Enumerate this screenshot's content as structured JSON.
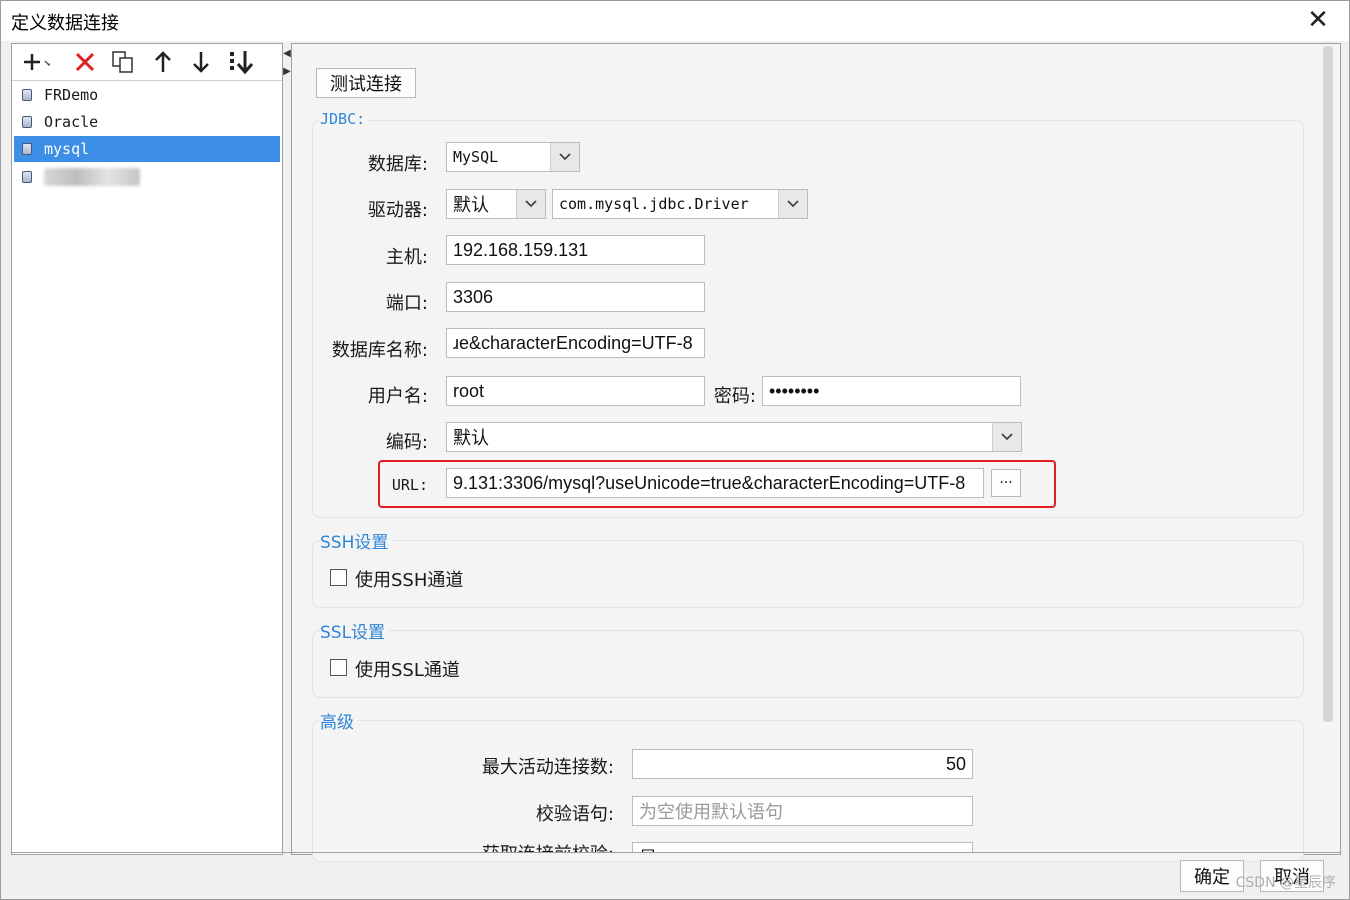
{
  "window": {
    "title": "定义数据连接",
    "close_glyph": "✕"
  },
  "toolbar": {
    "items": [
      {
        "name": "add",
        "glyph": "+▾"
      },
      {
        "name": "delete",
        "glyph": "✕"
      },
      {
        "name": "copy",
        "glyph": "⧉"
      },
      {
        "name": "move-up",
        "glyph": "↑"
      },
      {
        "name": "move-down",
        "glyph": "↓"
      },
      {
        "name": "sort",
        "glyph": "⇊"
      }
    ]
  },
  "connections": [
    {
      "label": "FRDemo",
      "selected": false
    },
    {
      "label": "Oracle",
      "selected": false
    },
    {
      "label": "mysql",
      "selected": true
    },
    {
      "label": "",
      "selected": false,
      "obscured": true
    }
  ],
  "right": {
    "test_button": "测试连接",
    "jdbc_section": "JDBC:",
    "labels": {
      "database": "数据库:",
      "driver": "驱动器:",
      "host": "主机:",
      "port": "端口:",
      "db_name": "数据库名称:",
      "username": "用户名:",
      "password": "密码:",
      "encoding": "编码:",
      "url": "URL:"
    },
    "values": {
      "database": "MySQL",
      "driver_mode": "默认",
      "driver_class": "com.mysql.jdbc.Driver",
      "host": "192.168.159.131",
      "port": "3306",
      "db_name": "ɹe&characterEncoding=UTF-8",
      "username": "root",
      "password": "••••••••",
      "encoding": "默认",
      "url": "9.131:3306/mysql?useUnicode=true&characterEncoding=UTF-8",
      "url_more": "···"
    },
    "ssh_section": "SSH设置",
    "ssh_checkbox": "使用SSH通道",
    "ssl_section": "SSL设置",
    "ssl_checkbox": "使用SSL通道",
    "advanced_section": "高级",
    "advanced": {
      "max_active_label": "最大活动连接数:",
      "max_active_value": "50",
      "validation_label": "校验语句:",
      "validation_placeholder": "为空使用默认语句",
      "partial_label": "获取连接前校验:",
      "partial_value": "是"
    }
  },
  "footer": {
    "ok": "确定",
    "cancel": "取消",
    "watermark": "CSDN @星辰序"
  },
  "colors": {
    "accent": "#2f86d6",
    "selection": "#3d8ee6",
    "highlight_border": "#e02020",
    "delete_icon": "#e02020"
  }
}
